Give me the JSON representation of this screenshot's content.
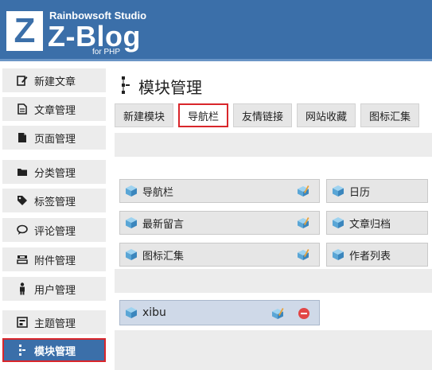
{
  "header": {
    "logo_letter": "Z",
    "studio": "Rainbowsoft Studio",
    "brand": "Z-Blog",
    "for_php": "for PHP"
  },
  "sidebar": {
    "items": [
      {
        "label": "新建文章",
        "icon": "edit-icon"
      },
      {
        "label": "文章管理",
        "icon": "document-icon"
      },
      {
        "label": "页面管理",
        "icon": "page-icon"
      },
      {
        "label": "分类管理",
        "icon": "folder-icon"
      },
      {
        "label": "标签管理",
        "icon": "tag-icon"
      },
      {
        "label": "评论管理",
        "icon": "comment-icon"
      },
      {
        "label": "附件管理",
        "icon": "attachment-icon"
      },
      {
        "label": "用户管理",
        "icon": "user-icon"
      },
      {
        "label": "主题管理",
        "icon": "theme-icon"
      },
      {
        "label": "模块管理",
        "icon": "module-icon"
      }
    ],
    "active_index": 9
  },
  "main": {
    "title": "模块管理",
    "tabs": [
      {
        "label": "新建模块"
      },
      {
        "label": "导航栏"
      },
      {
        "label": "友情链接"
      },
      {
        "label": "网站收藏"
      },
      {
        "label": "图标汇集"
      }
    ],
    "active_tab": 1,
    "widgets": [
      {
        "label": "导航栏"
      },
      {
        "label": "日历"
      },
      {
        "label": "最新留言"
      },
      {
        "label": "文章归档"
      },
      {
        "label": "图标汇集"
      },
      {
        "label": "作者列表"
      }
    ],
    "sidebar_module": {
      "label": "xibu"
    }
  },
  "colors": {
    "header_bg": "#3b6fa9",
    "active_bg": "#3b6fa9",
    "highlight_border": "#d9262b",
    "item_bg": "#ececec"
  }
}
